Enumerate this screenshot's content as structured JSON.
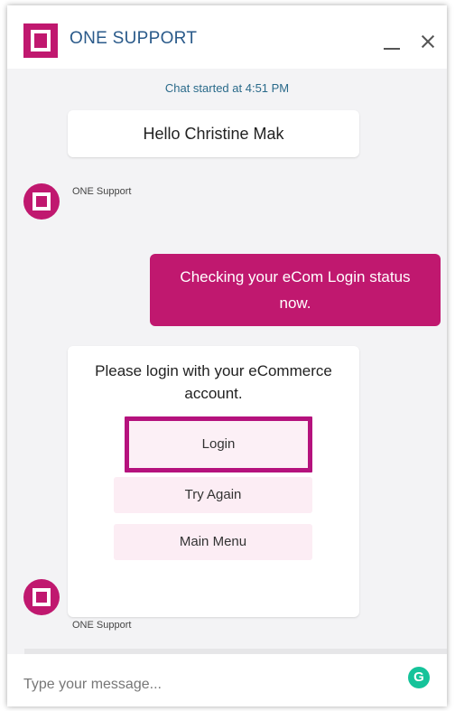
{
  "header": {
    "title": "ONE SUPPORT",
    "brand_color": "#c0186f",
    "icons": [
      "minimize-icon",
      "close-icon"
    ]
  },
  "chat": {
    "started_text": "Chat started at 4:51 PM",
    "greeting": "Hello Christine Mak",
    "sender_name_1": "ONE Support",
    "user_message": "Checking your eCom Login status now.",
    "prompt_text": "Please login with your eCommerce account.",
    "options": {
      "login": "Login",
      "try_again": "Try Again",
      "main_menu": "Main Menu"
    },
    "sender_name_2": "ONE Support"
  },
  "input": {
    "placeholder": "Type your message...",
    "value": ""
  },
  "extensions": {
    "grammarly_glyph": "G"
  }
}
